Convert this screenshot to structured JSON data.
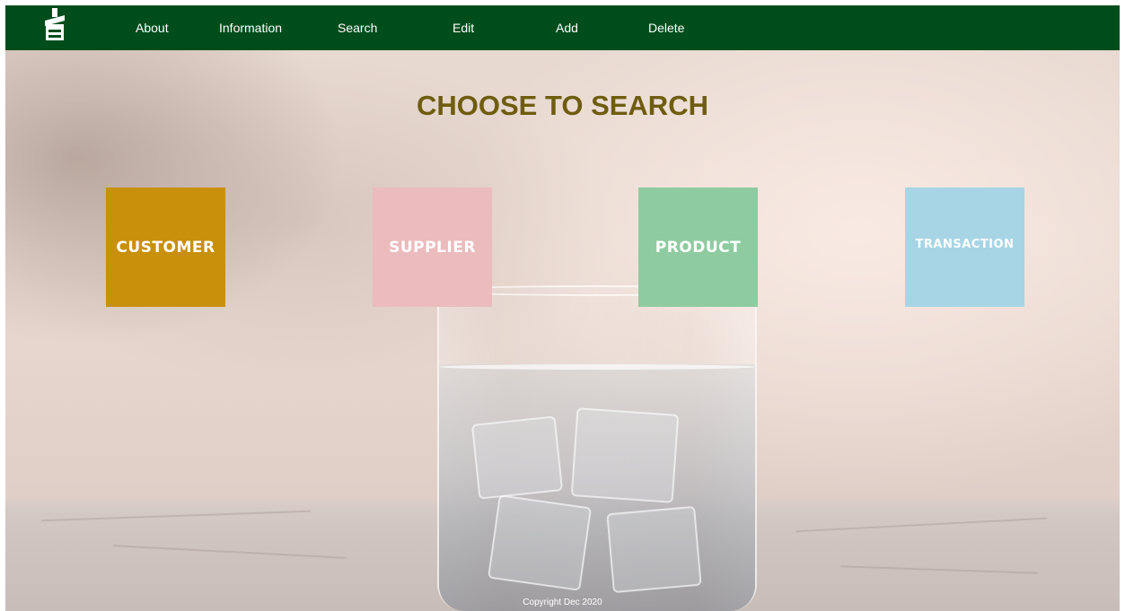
{
  "nav": {
    "items": [
      {
        "label": "About"
      },
      {
        "label": "Information"
      },
      {
        "label": "Search"
      },
      {
        "label": "Edit"
      },
      {
        "label": "Add"
      },
      {
        "label": "Delete"
      }
    ]
  },
  "main": {
    "title": "CHOOSE TO SEARCH",
    "tiles": [
      {
        "label": "CUSTOMER",
        "color": "#c8900b"
      },
      {
        "label": "SUPPLIER",
        "color": "#ebbbbd"
      },
      {
        "label": "PRODUCT",
        "color": "#8fcba0"
      },
      {
        "label": "TRANSACTION",
        "color": "#a7d5e5"
      }
    ]
  },
  "footer": {
    "copyright": "Copyright Dec 2020"
  },
  "colors": {
    "navbar": "#004d1c",
    "title": "#6e5d0e"
  }
}
